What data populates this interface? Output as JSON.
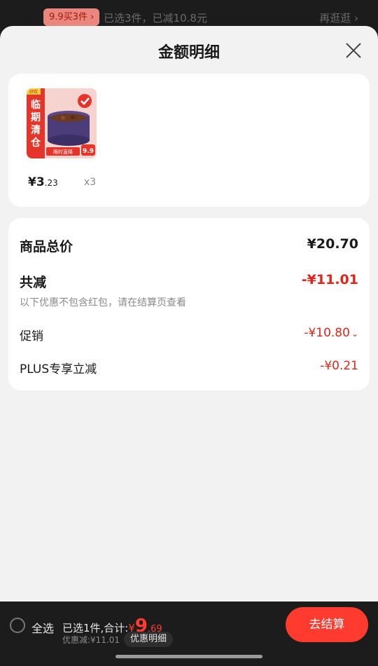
{
  "top": {
    "promo": "9.9买3件",
    "promo_arrow": "›",
    "selected_text": "已选3件，已减10.8元",
    "browse": "再逛逛 ›"
  },
  "sheet": {
    "title": "金额明细",
    "close_icon": "close-icon"
  },
  "product": {
    "price_int": "¥3",
    "price_dec": ".23",
    "qty": "x3",
    "thumb_labels": [
      "临",
      "期",
      "清",
      "仓"
    ],
    "thumb_brand": "好欢",
    "thumb_badge": "9.9",
    "thumb_banner": "限时直降"
  },
  "details": {
    "total_label": "商品总价",
    "total_value": "¥20.70",
    "reduce_label": "共减",
    "reduce_value": "-¥11.01",
    "note": "以下优惠不包含红包，请在结算页查看",
    "promo_label": "促销",
    "promo_value": "-¥10.80",
    "plus_label": "PLUS专享立减",
    "plus_value": "-¥0.21"
  },
  "bottom": {
    "select_all": "全选",
    "summary": "已选1件,合计:",
    "currency": "¥",
    "total_int": "9",
    "total_dec": ".69",
    "saved": "优惠减:¥11.01",
    "detail_toggle": "优惠明细",
    "checkout": "去结算"
  },
  "colors": {
    "accent_red": "#e1251b",
    "checkout_red": "#ff3b30"
  }
}
